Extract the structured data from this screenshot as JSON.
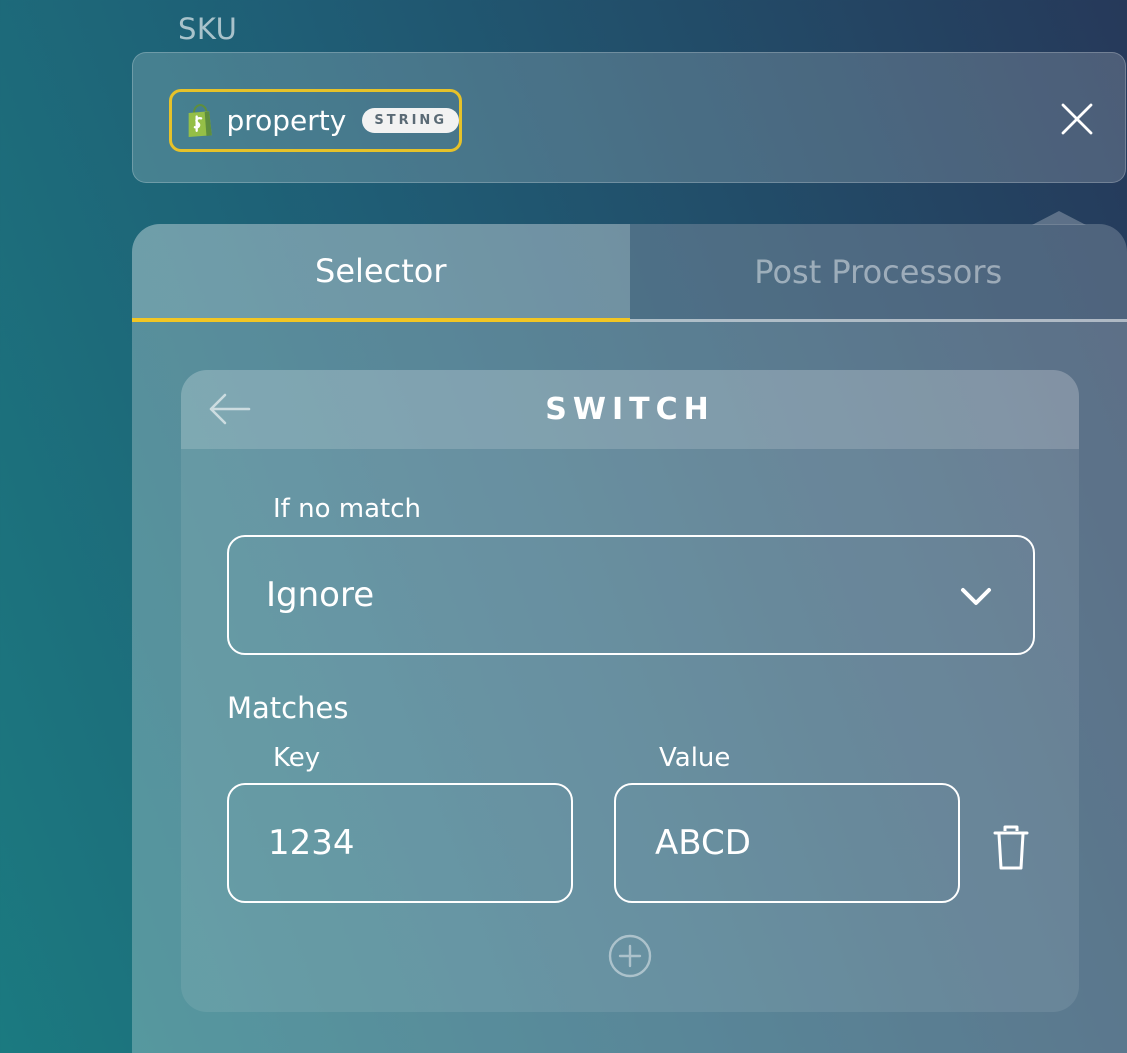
{
  "field": {
    "label": "SKU",
    "chip": {
      "icon": "shopify-bag-icon",
      "name": "property",
      "type": "STRING"
    },
    "close_icon": "close-icon"
  },
  "tabs": [
    {
      "label": "Selector",
      "active": true
    },
    {
      "label": "Post Processors",
      "active": false
    }
  ],
  "switch_card": {
    "title": "SWITCH",
    "back_icon": "arrow-left-icon",
    "no_match": {
      "label": "If no match",
      "selected": "Ignore"
    },
    "matches": {
      "heading": "Matches",
      "key_label": "Key",
      "value_label": "Value",
      "rows": [
        {
          "key": "1234",
          "value": "ABCD"
        }
      ],
      "delete_icon": "trash-icon",
      "add_icon": "plus-circle-icon"
    }
  },
  "colors": {
    "accent": "#f2c623",
    "chip_border": "#e6c229",
    "shopify_green": "#95bf47"
  }
}
